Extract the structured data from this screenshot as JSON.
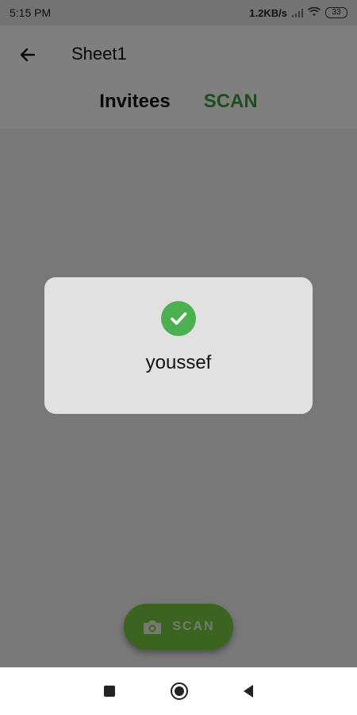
{
  "status_bar": {
    "time": "5:15 PM",
    "speed": "1.2KB/s",
    "battery": "33"
  },
  "app_bar": {
    "title": "Sheet1",
    "tabs": [
      {
        "label": "Invitees"
      },
      {
        "label": "SCAN"
      }
    ]
  },
  "fab": {
    "label": "SCAN",
    "icon": "camera-icon"
  },
  "dialog": {
    "icon": "check-circle-icon",
    "icon_color": "#4caf50",
    "message": "youssef"
  },
  "colors": {
    "accent_green": "#3d9b3f",
    "fab_green": "#79c943"
  }
}
